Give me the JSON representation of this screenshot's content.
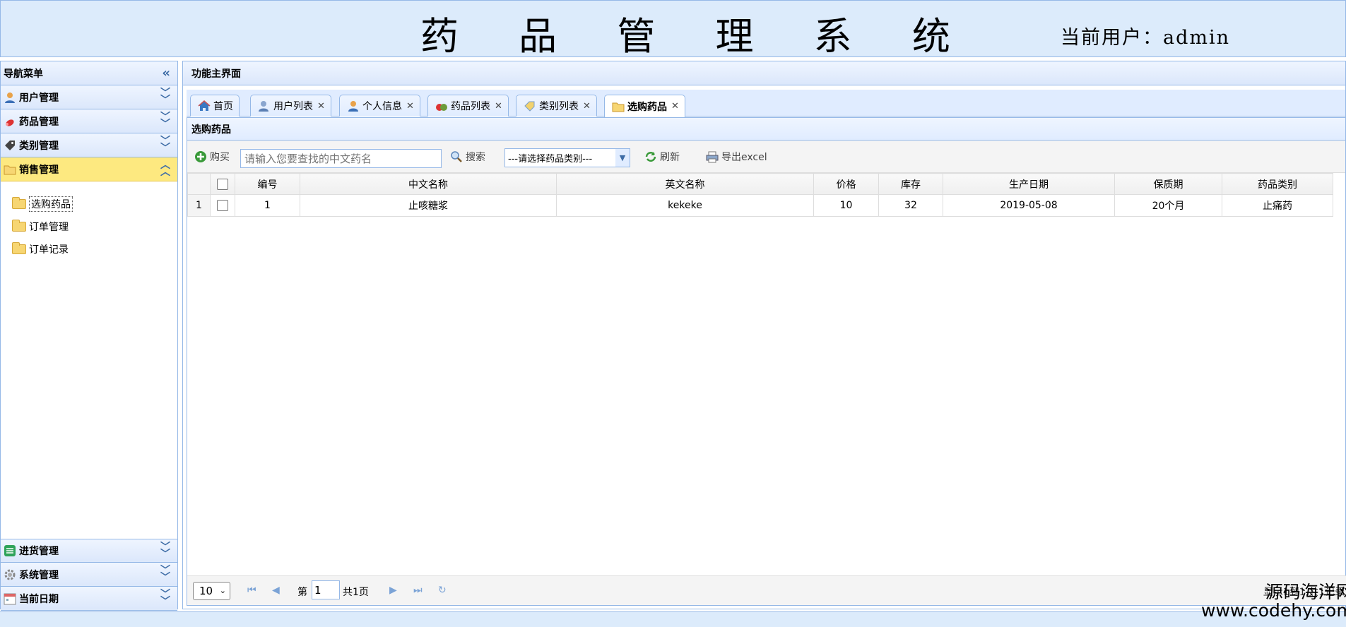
{
  "header": {
    "title": "药 品 管 理 系 统",
    "user_label": "当前用户：admin"
  },
  "sidebar": {
    "title": "导航菜单",
    "groups": [
      {
        "label": "用户管理",
        "icon": "user-icon"
      },
      {
        "label": "药品管理",
        "icon": "pill-icon"
      },
      {
        "label": "类别管理",
        "icon": "tag-icon"
      },
      {
        "label": "销售管理",
        "icon": "folder-icon",
        "active": true
      }
    ],
    "sub_items": [
      {
        "label": "选购药品",
        "selected": true
      },
      {
        "label": "订单管理"
      },
      {
        "label": "订单记录"
      }
    ],
    "bottom_groups": [
      {
        "label": "进货管理",
        "icon": "list-icon"
      },
      {
        "label": "系统管理",
        "icon": "gear-icon"
      },
      {
        "label": "当前日期",
        "icon": "calendar-icon"
      }
    ]
  },
  "main": {
    "title": "功能主界面",
    "tabs": [
      {
        "label": "首页",
        "icon": "home-icon",
        "closable": false
      },
      {
        "label": "用户列表",
        "icon": "user-list-icon",
        "closable": true
      },
      {
        "label": "个人信息",
        "icon": "person-icon",
        "closable": true
      },
      {
        "label": "药品列表",
        "icon": "pill-icon",
        "closable": true
      },
      {
        "label": "类别列表",
        "icon": "tag-icon",
        "closable": true
      },
      {
        "label": "选购药品",
        "icon": "folder-icon",
        "closable": true,
        "active": true
      }
    ],
    "panel_title": "选购药品",
    "toolbar": {
      "buy_label": "购买",
      "search_placeholder": "请输入您要查找的中文药名",
      "search_label": "搜索",
      "category_select": "---请选择药品类别---",
      "refresh_label": "刷新",
      "export_label": "导出excel"
    },
    "table": {
      "columns": [
        "编号",
        "中文名称",
        "英文名称",
        "价格",
        "库存",
        "生产日期",
        "保质期",
        "药品类别"
      ],
      "rows": [
        {
          "rownum": "1",
          "cells": [
            "1",
            "止咳糖浆",
            "kekeke",
            "10",
            "32",
            "2019-05-08",
            "20个月",
            "止痛药"
          ]
        }
      ]
    },
    "pager": {
      "page_size": "10",
      "page_prefix": "第",
      "page_value": "1",
      "page_suffix": "共1页",
      "info": "显示1到1,共1记录"
    }
  },
  "watermark": {
    "line1": "源码海洋网",
    "line2": "www.codehy.com"
  },
  "colors": {
    "border": "#95b8e7",
    "header_bg": "#dcebfb",
    "active_accordion": "#fde980"
  }
}
